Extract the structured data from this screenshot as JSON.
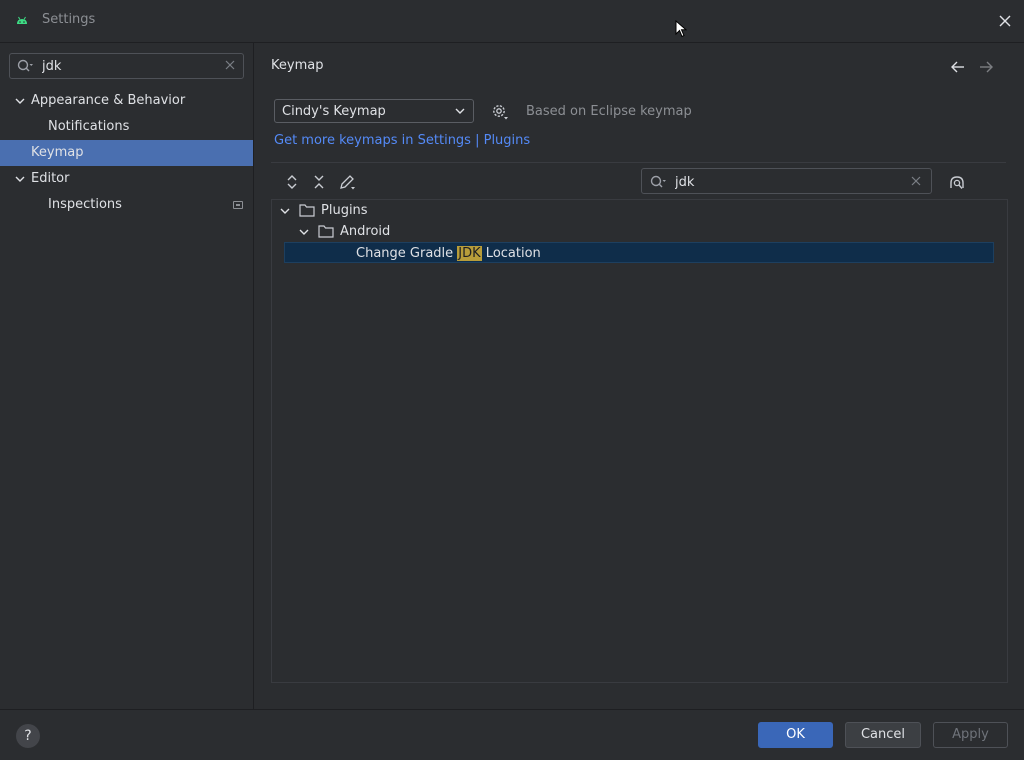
{
  "window": {
    "title": "Settings"
  },
  "sidebar": {
    "search": {
      "value": "jdk",
      "placeholder": ""
    },
    "items": [
      {
        "label": "Appearance & Behavior",
        "expanded": true
      },
      {
        "label": "Notifications"
      },
      {
        "label": "Keymap",
        "selected": true
      },
      {
        "label": "Editor",
        "expanded": true
      },
      {
        "label": "Inspections"
      }
    ]
  },
  "main": {
    "title": "Keymap",
    "keymap_select": {
      "value": "Cindy's Keymap"
    },
    "based_on": "Based on Eclipse keymap",
    "more_link": "Get more keymaps in Settings | Plugins",
    "action_search": {
      "value": "jdk",
      "placeholder": ""
    },
    "tree": {
      "root": "Plugins",
      "group": "Android",
      "action": {
        "before": "Change Gradle ",
        "highlight": "JDK",
        "after": " Location"
      }
    }
  },
  "footer": {
    "help": "?",
    "ok": "OK",
    "cancel": "Cancel",
    "apply": "Apply"
  },
  "colors": {
    "accent": "#4a6fb0",
    "link": "#548af7",
    "selection": "#0f2d4a",
    "highlight": "#b89d3a",
    "android_green": "#3ddc84"
  }
}
